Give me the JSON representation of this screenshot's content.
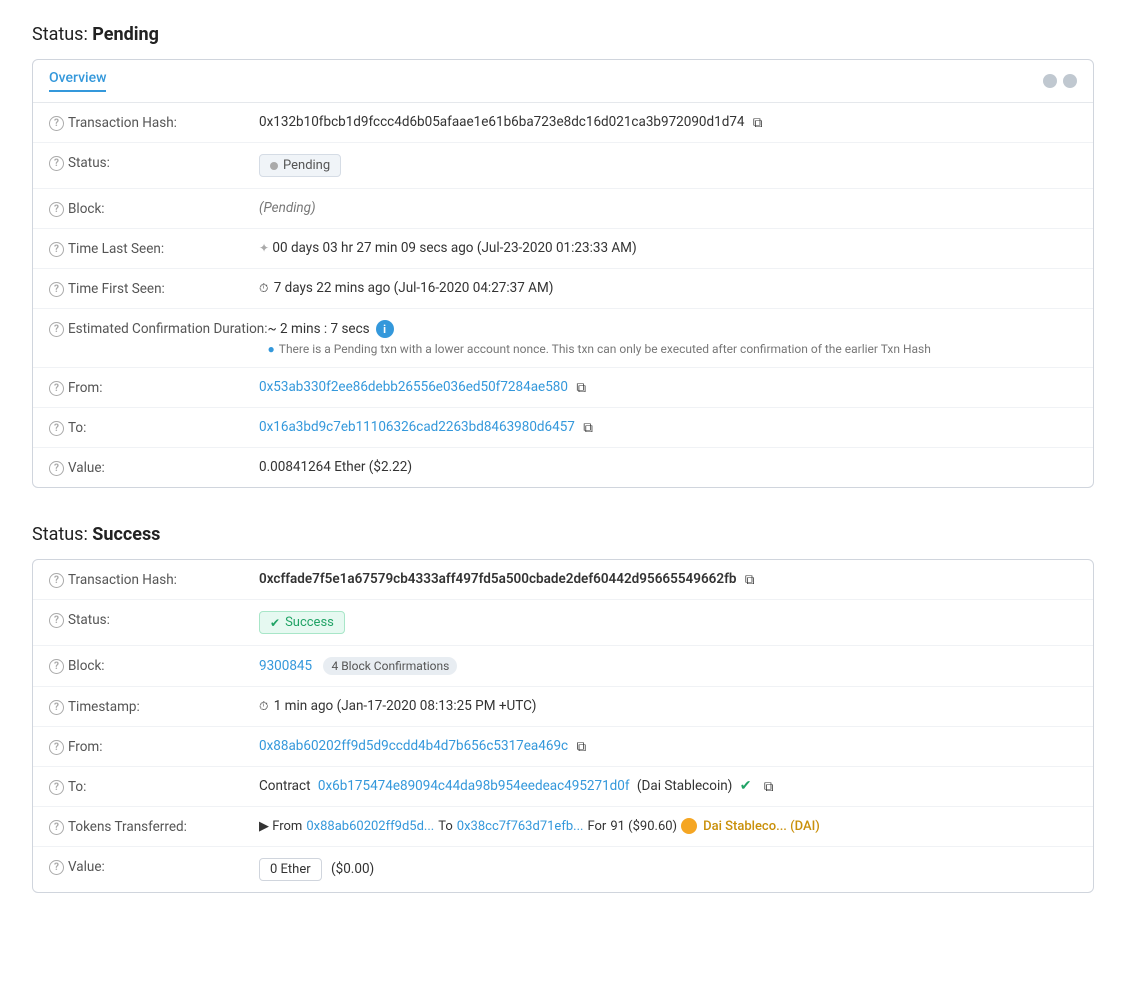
{
  "pending": {
    "section_title": "Status:",
    "section_bold": "Pending",
    "tab": "Overview",
    "rows": {
      "tx_hash_label": "Transaction Hash:",
      "tx_hash_value": "0x132b10fbcb1d9fccc4d6b05afaae1e61b6ba723e8dc16d021ca3b972090d1d74",
      "status_label": "Status:",
      "status_value": "Pending",
      "block_label": "Block:",
      "block_value": "(Pending)",
      "time_last_seen_label": "Time Last Seen:",
      "time_last_seen_value": "00 days 03 hr 27 min 09 secs ago (Jul-23-2020 01:23:33 AM)",
      "time_first_seen_label": "Time First Seen:",
      "time_first_seen_value": "7 days 22 mins ago (Jul-16-2020 04:27:37 AM)",
      "est_confirm_label": "Estimated Confirmation Duration:",
      "est_confirm_value": "~ 2 mins : 7 secs",
      "est_confirm_warning": "There is a Pending txn with a lower account nonce. This txn can only be executed after confirmation of the earlier Txn Hash",
      "from_label": "From:",
      "from_value": "0x53ab330f2ee86debb26556e036ed50f7284ae580",
      "to_label": "To:",
      "to_value": "0x16a3bd9c7eb11106326cad2263bd8463980d6457",
      "value_label": "Value:",
      "value_value": "0.00841264 Ether ($2.22)"
    }
  },
  "success": {
    "section_title": "Status:",
    "section_bold": "Success",
    "rows": {
      "tx_hash_label": "Transaction Hash:",
      "tx_hash_value": "0xcffade7f5e1a67579cb4333aff497fd5a500cbade2def60442d95665549662fb",
      "status_label": "Status:",
      "status_value": "Success",
      "block_label": "Block:",
      "block_number": "9300845",
      "block_confirmations": "4 Block Confirmations",
      "timestamp_label": "Timestamp:",
      "timestamp_value": "1 min ago (Jan-17-2020 08:13:25 PM +UTC)",
      "from_label": "From:",
      "from_value": "0x88ab60202ff9d5d9ccdd4b4d7b656c5317ea469c",
      "to_label": "To:",
      "to_contract_prefix": "Contract",
      "to_contract_address": "0x6b175474e89094c44da98b954eedeac495271d0f",
      "to_contract_name": "(Dai Stablecoin)",
      "tokens_transferred_label": "Tokens Transferred:",
      "tokens_from_prefix": "▶ From",
      "tokens_from": "0x88ab60202ff9d5d...",
      "tokens_to_prefix": "To",
      "tokens_to": "0x38cc7f763d71efb...",
      "tokens_for_prefix": "For",
      "tokens_amount": "91 ($90.60)",
      "tokens_name": "Dai Stableco... (DAI)",
      "value_label": "Value:",
      "value_ether": "0 Ether",
      "value_usd": "($0.00)"
    }
  },
  "icons": {
    "help": "?",
    "copy": "⧉",
    "clock": "⏱",
    "spinner": "✦",
    "check": "✔",
    "info": "i",
    "warning": "●",
    "arrow": "▶"
  }
}
